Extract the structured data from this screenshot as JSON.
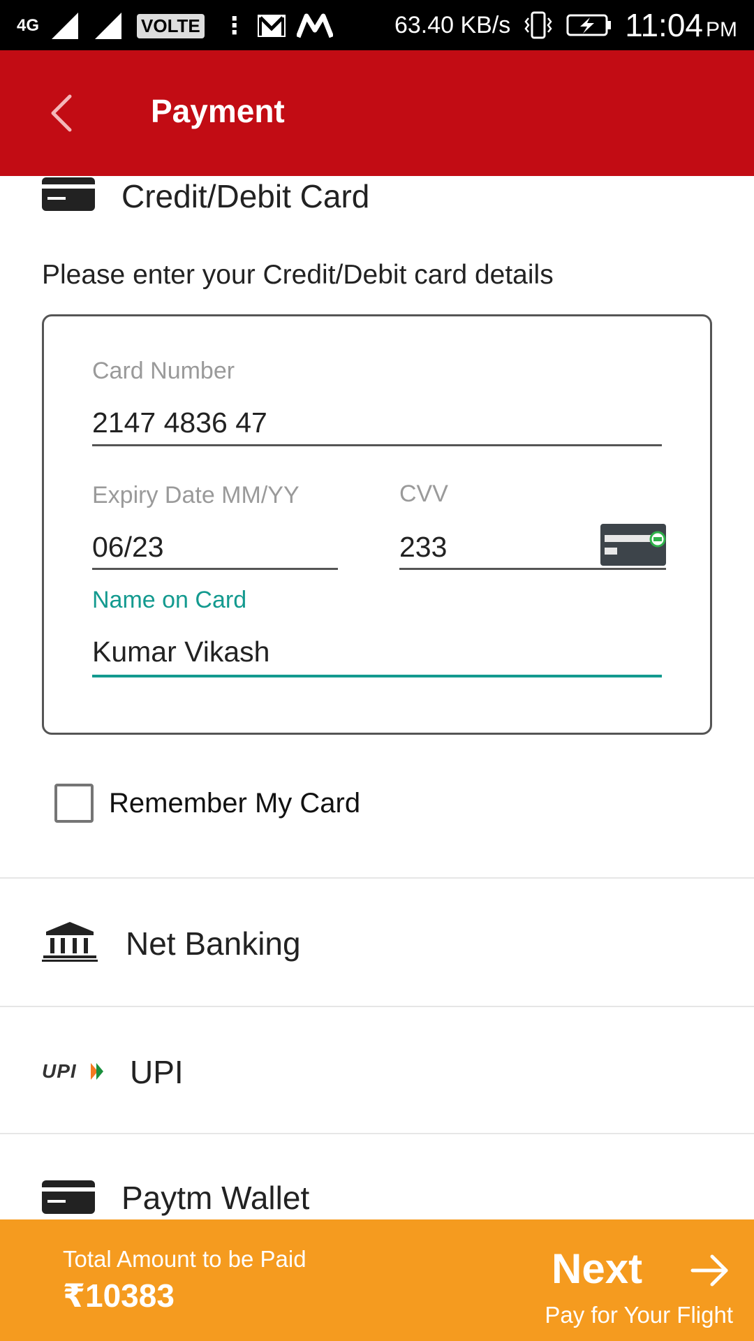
{
  "status_bar": {
    "network": "4G",
    "volte": "VOLTE",
    "speed": "63.40 KB/s",
    "time": "11:04",
    "ampm": "PM",
    "icons": [
      "signal-icon",
      "signal-icon",
      "more-icon",
      "gmail-icon",
      "myntra-icon",
      "vibrate-icon",
      "battery-charging-icon"
    ]
  },
  "app_bar": {
    "title": "Payment",
    "back_icon": "chevron-left-icon"
  },
  "card_section": {
    "label": "Credit/Debit Card",
    "icon": "card-icon",
    "instruction": "Please enter your Credit/Debit card details",
    "card_number": {
      "label": "Card Number",
      "value": "2147 4836 47"
    },
    "expiry": {
      "label": "Expiry Date MM/YY",
      "value": "06/23"
    },
    "cvv": {
      "label": "CVV",
      "value": "233",
      "icon": "cvv-card-icon"
    },
    "name": {
      "label": "Name on Card",
      "value": "Kumar Vikash"
    },
    "remember": {
      "label": "Remember My Card",
      "checked": false
    }
  },
  "payment_options": [
    {
      "label": "Net Banking",
      "icon": "bank-icon"
    },
    {
      "label": "UPI",
      "icon": "upi-icon"
    },
    {
      "label": "Paytm Wallet",
      "icon": "card-icon"
    }
  ],
  "footer": {
    "total_label": "Total Amount to be Paid",
    "total_amount": "₹10383",
    "next_label": "Next",
    "next_sub": "Pay for Your Flight",
    "next_icon": "arrow-right-icon"
  },
  "colors": {
    "app_bar": "#c20c14",
    "accent": "#139a8f",
    "footer": "#f59b1f"
  }
}
